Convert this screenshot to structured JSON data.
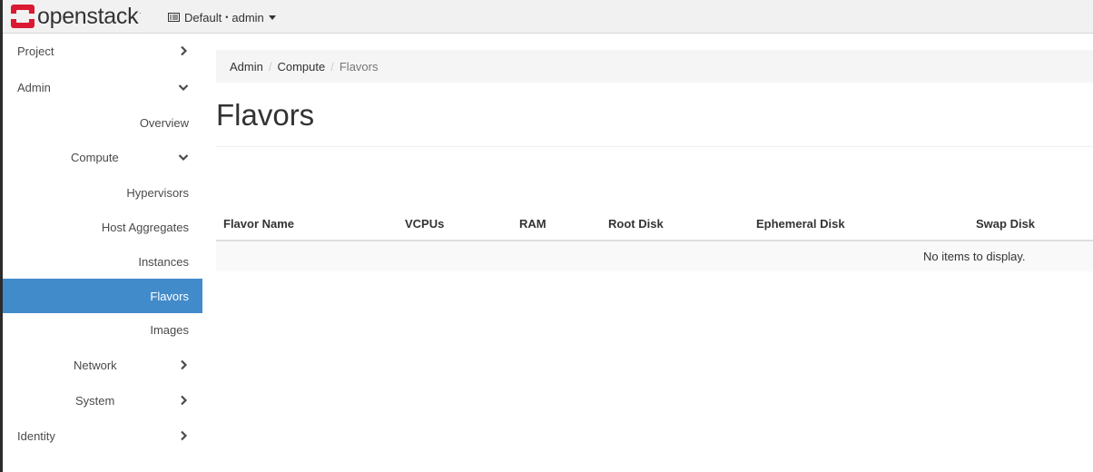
{
  "header": {
    "brand": "openstack",
    "brand_mark": ".",
    "context_domain": "Default",
    "context_separator": "•",
    "context_user": "admin",
    "brand_color": "#da1a32"
  },
  "sidebar": {
    "project": "Project",
    "admin": "Admin",
    "overview": "Overview",
    "compute": "Compute",
    "hypervisors": "Hypervisors",
    "host_aggregates": "Host Aggregates",
    "instances": "Instances",
    "flavors": "Flavors",
    "images": "Images",
    "network": "Network",
    "system": "System",
    "identity": "Identity",
    "active_color": "#428bca"
  },
  "breadcrumb": {
    "level1": "Admin",
    "level2": "Compute",
    "level3": "Flavors",
    "separator": "/"
  },
  "page": {
    "title": "Flavors"
  },
  "table": {
    "columns": [
      "Flavor Name",
      "VCPUs",
      "RAM",
      "Root Disk",
      "Ephemeral Disk",
      "Swap Disk"
    ],
    "empty_message": "No items to display."
  }
}
